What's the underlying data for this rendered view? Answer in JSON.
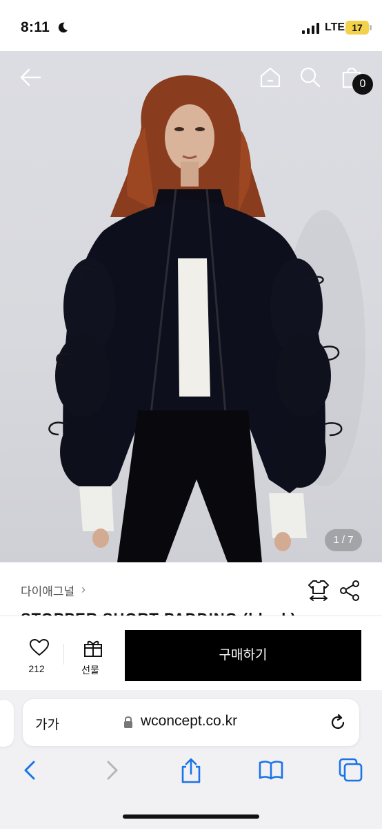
{
  "status_bar": {
    "time": "8:11",
    "network": "LTE",
    "battery": "17"
  },
  "hero": {
    "cart_count": "0",
    "image_counter": "1 / 7"
  },
  "product": {
    "brand": "다이애그널",
    "brand_chevron": "›",
    "title": "STOPPER SHORT PADDING (black)"
  },
  "actions": {
    "like_count": "212",
    "gift_label": "선물",
    "buy_label": "구매하기"
  },
  "browser": {
    "text_size_label": "가가",
    "url": "wconcept.co.kr"
  },
  "colors": {
    "buy_button": "#000000",
    "badge": "#111111",
    "safari_blue": "#1a73e8",
    "battery": "#f2d24a"
  },
  "icons": [
    "back-arrow-icon",
    "home-icon",
    "search-icon",
    "shopping-bag-icon",
    "size-guide-icon",
    "share-icon",
    "heart-icon",
    "gift-icon",
    "lock-icon",
    "reload-icon",
    "safari-back-icon",
    "safari-forward-icon",
    "safari-share-icon",
    "bookmarks-icon",
    "tabs-icon"
  ]
}
